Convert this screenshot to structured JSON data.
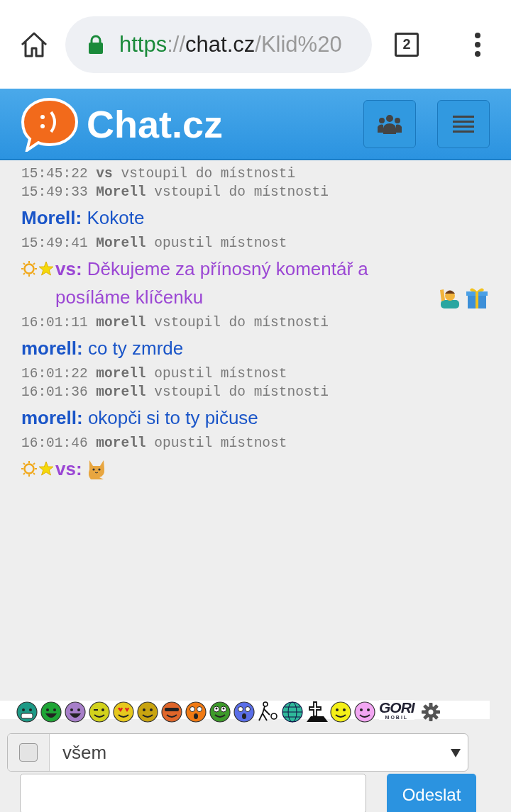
{
  "browser": {
    "url": {
      "scheme": "https",
      "separator": "://",
      "host": "chat.cz",
      "path": "/Klid%20"
    },
    "tab_count": "2"
  },
  "header": {
    "logo_text": "Chat.cz"
  },
  "log": [
    {
      "kind": "system",
      "time": "15:45:22",
      "user": "vs",
      "text": "vstoupil do místnosti"
    },
    {
      "kind": "system",
      "time": "15:49:33",
      "user": "Morell",
      "text": "vstoupil do místnosti"
    },
    {
      "kind": "message",
      "user": "Morell:",
      "text": "Kokote",
      "color": "#1a55c8"
    },
    {
      "kind": "system",
      "time": "15:49:41",
      "user": "Morell",
      "text": "opustil místnost"
    },
    {
      "kind": "message",
      "user": "vs:",
      "text": "Děkujeme za přínosný komentář a posíláme klíčenku",
      "color": "#9b47d4",
      "badges": [
        {
          "kind": "sun"
        },
        {
          "kind": "star"
        }
      ],
      "attachments": [
        {
          "kind": "person"
        },
        {
          "kind": "gift"
        }
      ]
    },
    {
      "kind": "system",
      "time": "16:01:11",
      "user": "morell",
      "text": "vstoupil do místnosti"
    },
    {
      "kind": "message",
      "user": "morell:",
      "text": "co ty zmrde",
      "color": "#1a55c8"
    },
    {
      "kind": "system",
      "time": "16:01:22",
      "user": "morell",
      "text": "opustil místnost"
    },
    {
      "kind": "system",
      "time": "16:01:36",
      "user": "morell",
      "text": "vstoupil do místnosti"
    },
    {
      "kind": "message",
      "user": "morell:",
      "text": "okopči si to ty pičuse",
      "color": "#1a55c8"
    },
    {
      "kind": "system",
      "time": "16:01:46",
      "user": "morell",
      "text": "opustil místnost"
    },
    {
      "kind": "message",
      "user": "vs:",
      "color": "#9b47d4",
      "badges": [
        {
          "kind": "sun"
        },
        {
          "kind": "star"
        }
      ],
      "attachments": [
        {
          "kind": "cat"
        }
      ]
    }
  ],
  "smileys": [
    {
      "kind": "grin",
      "color": "#1e9a86"
    },
    {
      "kind": "laugh",
      "color": "#1fa536"
    },
    {
      "kind": "laugh",
      "color": "#a77fc9"
    },
    {
      "kind": "wink",
      "color": "#d2d21c"
    },
    {
      "kind": "love",
      "color": "#e6c81e"
    },
    {
      "kind": "smile",
      "color": "#c9a410"
    },
    {
      "kind": "cool",
      "color": "#e0662a"
    },
    {
      "kind": "shock",
      "color": "#f07a14"
    },
    {
      "kind": "eyes",
      "color": "#3d9a2a"
    },
    {
      "kind": "shock",
      "color": "#5a6ee8"
    },
    {
      "kind": "figure"
    },
    {
      "kind": "globe",
      "color": "#2fb89a"
    },
    {
      "kind": "grave"
    },
    {
      "kind": "smile",
      "color": "#f4f018"
    },
    {
      "kind": "smile",
      "color": "#f2a6f2"
    }
  ],
  "banner": {
    "title": "GORI",
    "subtitle": "MOBIL"
  },
  "recipient": {
    "checked": false,
    "value": "všem"
  },
  "send_button": "Odeslat"
}
